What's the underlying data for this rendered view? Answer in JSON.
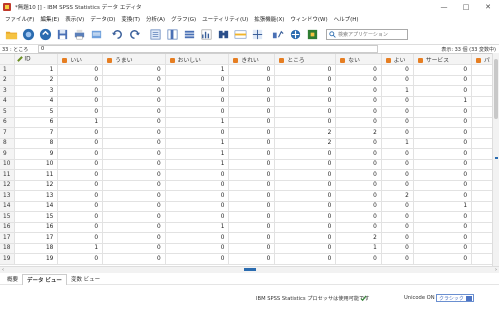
{
  "window": {
    "title": "*無題10 [] - IBM SPSS Statistics データ エディタ",
    "minimize": "—",
    "maximize": "□",
    "close": "✕"
  },
  "menu": [
    "ファイル(F)",
    "編集(E)",
    "表示(V)",
    "データ(D)",
    "変換(T)",
    "分析(A)",
    "グラフ(G)",
    "ユーティリティ(U)",
    "拡張機能(X)",
    "ウィンドウ(W)",
    "ヘルプ(H)"
  ],
  "toolbar": {
    "search_placeholder": "検索アプリケーション"
  },
  "cellbar": {
    "ref": "33 : ところ",
    "value": "0",
    "display_info": "表示: 33 個 (33 変数中)"
  },
  "columns": [
    "ID",
    "いい",
    "うまい",
    "おいしい",
    "きれい",
    "ところ",
    "ない",
    "よい",
    "サービス",
    "パ"
  ],
  "rows": [
    [
      1,
      0,
      0,
      1,
      0,
      0,
      0,
      0,
      0
    ],
    [
      2,
      0,
      0,
      0,
      0,
      0,
      0,
      0,
      0
    ],
    [
      3,
      0,
      0,
      0,
      0,
      0,
      0,
      1,
      0
    ],
    [
      4,
      0,
      0,
      0,
      0,
      0,
      0,
      0,
      1
    ],
    [
      5,
      0,
      0,
      0,
      0,
      0,
      0,
      0,
      0
    ],
    [
      6,
      1,
      0,
      1,
      0,
      0,
      0,
      0,
      0
    ],
    [
      7,
      0,
      0,
      0,
      0,
      2,
      2,
      0,
      0
    ],
    [
      8,
      0,
      0,
      1,
      0,
      2,
      0,
      1,
      0
    ],
    [
      9,
      0,
      0,
      1,
      0,
      0,
      0,
      0,
      0
    ],
    [
      10,
      0,
      0,
      1,
      0,
      0,
      0,
      0,
      0
    ],
    [
      11,
      0,
      0,
      0,
      0,
      0,
      0,
      0,
      0
    ],
    [
      12,
      0,
      0,
      0,
      0,
      0,
      0,
      0,
      0
    ],
    [
      13,
      0,
      0,
      0,
      0,
      0,
      0,
      2,
      0
    ],
    [
      14,
      0,
      0,
      0,
      0,
      0,
      0,
      0,
      1
    ],
    [
      15,
      0,
      0,
      0,
      0,
      0,
      0,
      0,
      0
    ],
    [
      16,
      0,
      0,
      1,
      0,
      0,
      0,
      0,
      0
    ],
    [
      17,
      0,
      0,
      0,
      0,
      0,
      2,
      0,
      0
    ],
    [
      18,
      1,
      0,
      0,
      0,
      0,
      1,
      0,
      0
    ],
    [
      19,
      0,
      0,
      0,
      0,
      0,
      0,
      0,
      0
    ]
  ],
  "tabs": [
    "概要",
    "データ ビュー",
    "変数 ビュー"
  ],
  "status": {
    "processor": "IBM SPSS Statistics プロセッサは使用可能です",
    "unicode": "Unicode ON",
    "mode": "クラシック"
  },
  "colors": {
    "accent": "#4d74c4",
    "header_bg": "#f4f4f4"
  }
}
